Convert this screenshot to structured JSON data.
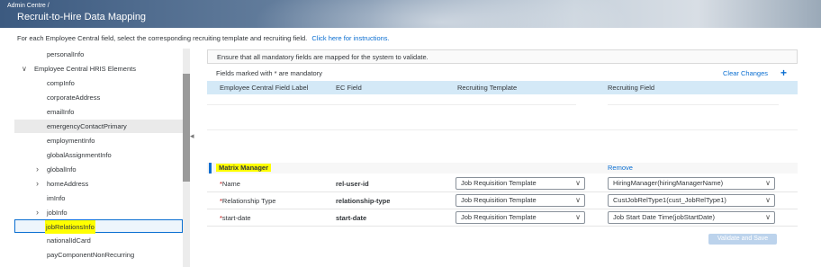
{
  "header": {
    "breadcrumb": "Admin Centre /",
    "title": "Recruit-to-Hire Data Mapping"
  },
  "instructions": {
    "text": "For each Employee Central field, select the corresponding recruiting template and recruiting field.",
    "link": "Click here for instructions."
  },
  "sidebar": {
    "items": [
      {
        "label": "personalInfo"
      },
      {
        "label": "Employee Central HRIS Elements"
      },
      {
        "label": "compInfo"
      },
      {
        "label": "corporateAddress"
      },
      {
        "label": "emailInfo"
      },
      {
        "label": "emergencyContactPrimary"
      },
      {
        "label": "employmentInfo"
      },
      {
        "label": "globalAssignmentInfo"
      },
      {
        "label": "globalInfo"
      },
      {
        "label": "homeAddress"
      },
      {
        "label": "imInfo"
      },
      {
        "label": "jobInfo"
      },
      {
        "label": "jobRelationsInfo"
      },
      {
        "label": "nationalIdCard"
      },
      {
        "label": "payComponentNonRecurring"
      }
    ]
  },
  "main": {
    "info_banner": "Ensure that all mandatory fields are mapped for the system to validate.",
    "mandatory_note": "Fields marked with * are mandatory",
    "clear_changes": "Clear Changes",
    "add_symbol": "+",
    "columns": [
      "Employee Central Field Label",
      "EC Field",
      "Recruiting Template",
      "Recruiting Field"
    ],
    "group": {
      "title": "Matrix Manager",
      "remove": "Remove"
    },
    "rows": [
      {
        "required": "*",
        "label": "Name",
        "ec_field": "rel-user-id",
        "template": "Job Requisition Template",
        "field": "HiringManager(hiringManagerName)"
      },
      {
        "required": "*",
        "label": "Relationship Type",
        "ec_field": "relationship-type",
        "template": "Job Requisition Template",
        "field": "CustJobRelType1(cust_JobRelType1)"
      },
      {
        "required": "*",
        "label": "start-date",
        "ec_field": "start-date",
        "template": "Job Requisition Template",
        "field": "Job Start Date Time(jobStartDate)"
      }
    ],
    "validate_button": "Validate and Save"
  },
  "colors": {
    "accent": "#0a6ed1",
    "highlight": "#ffff00",
    "table_header_bg": "#d4e9f7",
    "required": "#bb0000"
  }
}
